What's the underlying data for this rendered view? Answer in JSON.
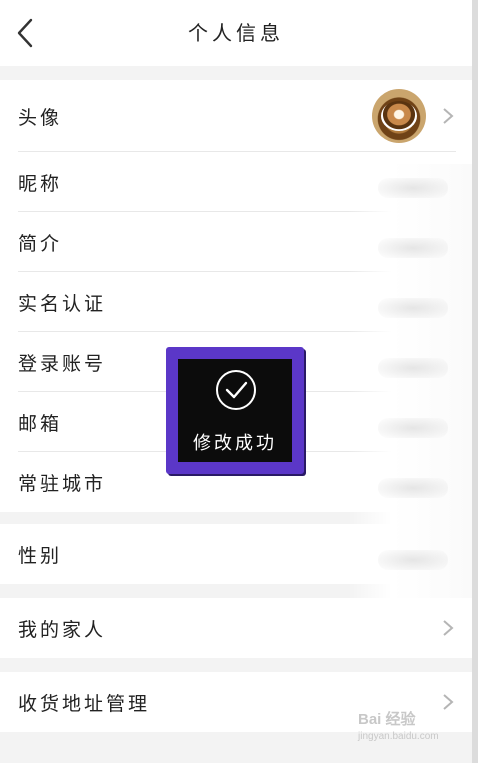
{
  "header": {
    "title": "个人信息",
    "back_icon": "chevron-left-icon"
  },
  "profile": {
    "avatar": {
      "label": "头像",
      "icon": "coffee-cup-avatar"
    },
    "nickname": {
      "label": "昵称"
    },
    "bio": {
      "label": "简介"
    },
    "verification": {
      "label": "实名认证"
    },
    "login_account": {
      "label": "登录账号"
    },
    "email": {
      "label": "邮箱"
    },
    "city": {
      "label": "常驻城市"
    }
  },
  "gender": {
    "label": "性别"
  },
  "family": {
    "label": "我的家人"
  },
  "address": {
    "label": "收货地址管理"
  },
  "toast": {
    "text": "修改成功",
    "icon": "checkmark-circle-icon"
  },
  "watermark": {
    "text": "Bai 经验",
    "url": "jingyan.baidu.com"
  },
  "colors": {
    "toast_border": "#5b37c8",
    "toast_bg": "#0c0c0c",
    "page_bg": "#f3f3f3"
  }
}
